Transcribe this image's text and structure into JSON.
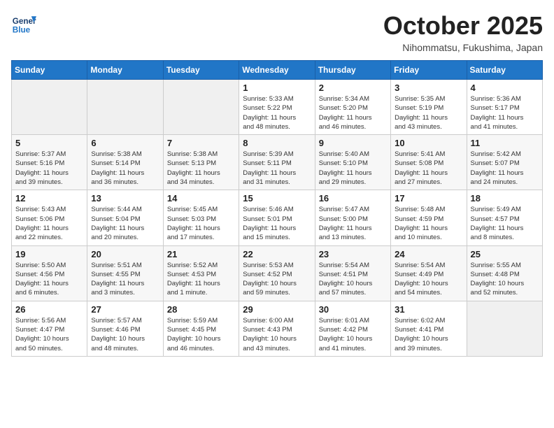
{
  "header": {
    "logo_general": "General",
    "logo_blue": "Blue",
    "month_title": "October 2025",
    "location": "Nihommatsu, Fukushima, Japan"
  },
  "calendar": {
    "days_of_week": [
      "Sunday",
      "Monday",
      "Tuesday",
      "Wednesday",
      "Thursday",
      "Friday",
      "Saturday"
    ],
    "weeks": [
      [
        {
          "day": "",
          "info": ""
        },
        {
          "day": "",
          "info": ""
        },
        {
          "day": "",
          "info": ""
        },
        {
          "day": "1",
          "info": "Sunrise: 5:33 AM\nSunset: 5:22 PM\nDaylight: 11 hours\nand 48 minutes."
        },
        {
          "day": "2",
          "info": "Sunrise: 5:34 AM\nSunset: 5:20 PM\nDaylight: 11 hours\nand 46 minutes."
        },
        {
          "day": "3",
          "info": "Sunrise: 5:35 AM\nSunset: 5:19 PM\nDaylight: 11 hours\nand 43 minutes."
        },
        {
          "day": "4",
          "info": "Sunrise: 5:36 AM\nSunset: 5:17 PM\nDaylight: 11 hours\nand 41 minutes."
        }
      ],
      [
        {
          "day": "5",
          "info": "Sunrise: 5:37 AM\nSunset: 5:16 PM\nDaylight: 11 hours\nand 39 minutes."
        },
        {
          "day": "6",
          "info": "Sunrise: 5:38 AM\nSunset: 5:14 PM\nDaylight: 11 hours\nand 36 minutes."
        },
        {
          "day": "7",
          "info": "Sunrise: 5:38 AM\nSunset: 5:13 PM\nDaylight: 11 hours\nand 34 minutes."
        },
        {
          "day": "8",
          "info": "Sunrise: 5:39 AM\nSunset: 5:11 PM\nDaylight: 11 hours\nand 31 minutes."
        },
        {
          "day": "9",
          "info": "Sunrise: 5:40 AM\nSunset: 5:10 PM\nDaylight: 11 hours\nand 29 minutes."
        },
        {
          "day": "10",
          "info": "Sunrise: 5:41 AM\nSunset: 5:08 PM\nDaylight: 11 hours\nand 27 minutes."
        },
        {
          "day": "11",
          "info": "Sunrise: 5:42 AM\nSunset: 5:07 PM\nDaylight: 11 hours\nand 24 minutes."
        }
      ],
      [
        {
          "day": "12",
          "info": "Sunrise: 5:43 AM\nSunset: 5:06 PM\nDaylight: 11 hours\nand 22 minutes."
        },
        {
          "day": "13",
          "info": "Sunrise: 5:44 AM\nSunset: 5:04 PM\nDaylight: 11 hours\nand 20 minutes."
        },
        {
          "day": "14",
          "info": "Sunrise: 5:45 AM\nSunset: 5:03 PM\nDaylight: 11 hours\nand 17 minutes."
        },
        {
          "day": "15",
          "info": "Sunrise: 5:46 AM\nSunset: 5:01 PM\nDaylight: 11 hours\nand 15 minutes."
        },
        {
          "day": "16",
          "info": "Sunrise: 5:47 AM\nSunset: 5:00 PM\nDaylight: 11 hours\nand 13 minutes."
        },
        {
          "day": "17",
          "info": "Sunrise: 5:48 AM\nSunset: 4:59 PM\nDaylight: 11 hours\nand 10 minutes."
        },
        {
          "day": "18",
          "info": "Sunrise: 5:49 AM\nSunset: 4:57 PM\nDaylight: 11 hours\nand 8 minutes."
        }
      ],
      [
        {
          "day": "19",
          "info": "Sunrise: 5:50 AM\nSunset: 4:56 PM\nDaylight: 11 hours\nand 6 minutes."
        },
        {
          "day": "20",
          "info": "Sunrise: 5:51 AM\nSunset: 4:55 PM\nDaylight: 11 hours\nand 3 minutes."
        },
        {
          "day": "21",
          "info": "Sunrise: 5:52 AM\nSunset: 4:53 PM\nDaylight: 11 hours\nand 1 minute."
        },
        {
          "day": "22",
          "info": "Sunrise: 5:53 AM\nSunset: 4:52 PM\nDaylight: 10 hours\nand 59 minutes."
        },
        {
          "day": "23",
          "info": "Sunrise: 5:54 AM\nSunset: 4:51 PM\nDaylight: 10 hours\nand 57 minutes."
        },
        {
          "day": "24",
          "info": "Sunrise: 5:54 AM\nSunset: 4:49 PM\nDaylight: 10 hours\nand 54 minutes."
        },
        {
          "day": "25",
          "info": "Sunrise: 5:55 AM\nSunset: 4:48 PM\nDaylight: 10 hours\nand 52 minutes."
        }
      ],
      [
        {
          "day": "26",
          "info": "Sunrise: 5:56 AM\nSunset: 4:47 PM\nDaylight: 10 hours\nand 50 minutes."
        },
        {
          "day": "27",
          "info": "Sunrise: 5:57 AM\nSunset: 4:46 PM\nDaylight: 10 hours\nand 48 minutes."
        },
        {
          "day": "28",
          "info": "Sunrise: 5:59 AM\nSunset: 4:45 PM\nDaylight: 10 hours\nand 46 minutes."
        },
        {
          "day": "29",
          "info": "Sunrise: 6:00 AM\nSunset: 4:43 PM\nDaylight: 10 hours\nand 43 minutes."
        },
        {
          "day": "30",
          "info": "Sunrise: 6:01 AM\nSunset: 4:42 PM\nDaylight: 10 hours\nand 41 minutes."
        },
        {
          "day": "31",
          "info": "Sunrise: 6:02 AM\nSunset: 4:41 PM\nDaylight: 10 hours\nand 39 minutes."
        },
        {
          "day": "",
          "info": ""
        }
      ]
    ]
  }
}
